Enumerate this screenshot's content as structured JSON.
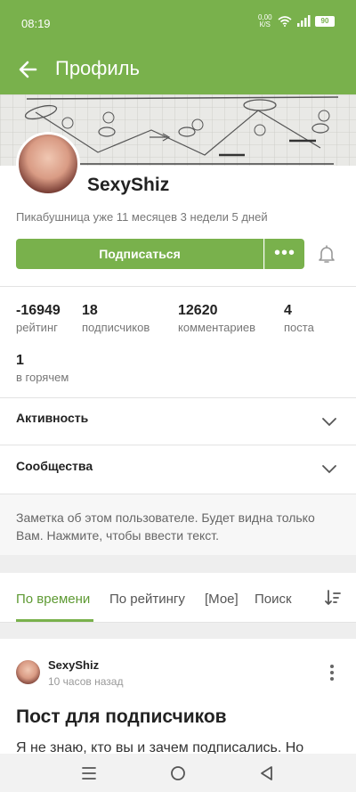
{
  "status_bar": {
    "time": "08:19",
    "net_speed": "0,00",
    "net_unit": "К/S",
    "battery": "90"
  },
  "app_bar": {
    "title": "Профиль"
  },
  "profile": {
    "username": "SexyShiz",
    "member_since": "Пикабушница уже 11 месяцев 3 недели 5 дней",
    "subscribe_label": "Подписаться",
    "more_label": "•••"
  },
  "stats": [
    {
      "value": "-16949",
      "label": "рейтинг"
    },
    {
      "value": "18",
      "label": "подписчиков"
    },
    {
      "value": "12620",
      "label": "комментариев"
    },
    {
      "value": "4",
      "label": "поста"
    },
    {
      "value": "1",
      "label": "в горячем"
    }
  ],
  "sections": {
    "activity": "Активность",
    "communities": "Сообщества"
  },
  "note": {
    "placeholder": "Заметка об этом пользователе. Будет видна только Вам. Нажмите, чтобы ввести текст."
  },
  "tabs": [
    {
      "label": "По времени",
      "active": true
    },
    {
      "label": "По рейтингу",
      "active": false
    },
    {
      "label": "[Мое]",
      "active": false
    },
    {
      "label": "Поиск",
      "active": false
    }
  ],
  "post": {
    "author": "SexyShiz",
    "time": "10 часов назад",
    "title": "Пост для подписчиков",
    "text": "Я не знаю, кто вы и зачем подписались. Но"
  },
  "colors": {
    "accent": "#79b14c",
    "accent_dark": "#5e9a33"
  }
}
